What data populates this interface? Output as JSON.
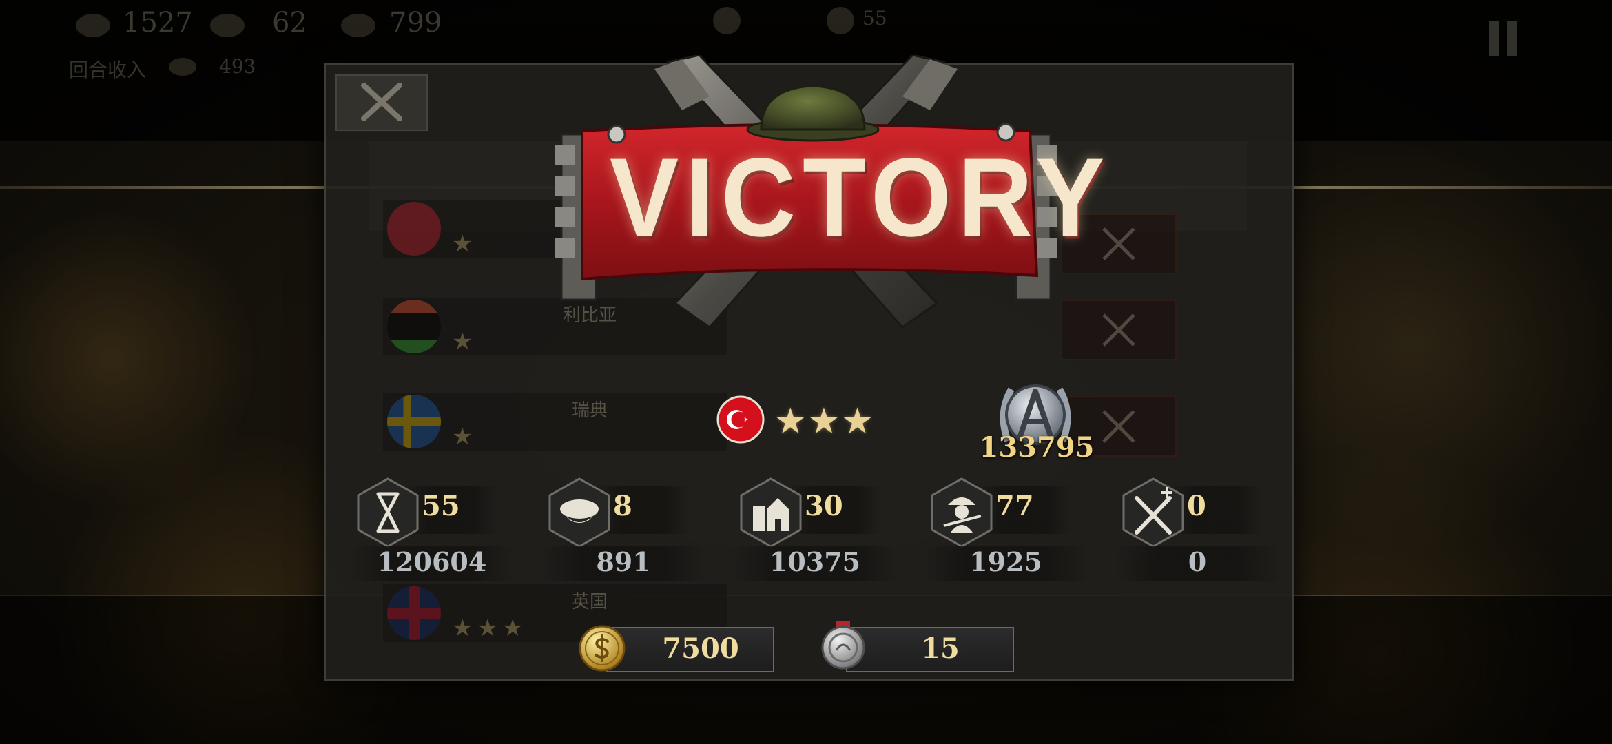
{
  "hud": {
    "gold": "1527",
    "manpower": "62",
    "industry": "799",
    "turn_income_label": "回合收入",
    "turn_income_gold": "493",
    "enemy_count": "55"
  },
  "nations": [
    {
      "name": "",
      "stars": "★",
      "flag_icon": "turkey-flag-icon"
    },
    {
      "name": "利比亚",
      "stars": "★",
      "flag_icon": "libya-flag-icon"
    },
    {
      "name": "瑞典",
      "stars": "★",
      "flag_icon": "sweden-flag-icon"
    },
    {
      "name": "英国",
      "stars": "★★★",
      "flag_icon": "uk-flag-icon"
    }
  ],
  "banner": {
    "title": "VICTORY"
  },
  "player": {
    "flag_icon": "turkey-flag-icon",
    "stars": "★★★",
    "rating": 3,
    "score": "133795",
    "score_icon": "laurel-medal-icon"
  },
  "stats": [
    {
      "icon": "hourglass-icon",
      "count": "55",
      "total": "120604"
    },
    {
      "icon": "officer-cap-icon",
      "count": "8",
      "total": "891"
    },
    {
      "icon": "city-building-icon",
      "count": "30",
      "total": "10375"
    },
    {
      "icon": "soldier-icon",
      "count": "77",
      "total": "1925"
    },
    {
      "icon": "crossed-swords-icon",
      "count": "0",
      "total": "0"
    }
  ],
  "rewards": {
    "gold": {
      "icon": "gold-coin-icon",
      "value": "7500"
    },
    "medal": {
      "icon": "silver-medal-icon",
      "value": "15"
    }
  },
  "colors": {
    "accent_gold": "#f1dca0",
    "banner_red": "#b71c22",
    "total_silver": "#b8bdc2",
    "star_gold": "#e9d196"
  }
}
